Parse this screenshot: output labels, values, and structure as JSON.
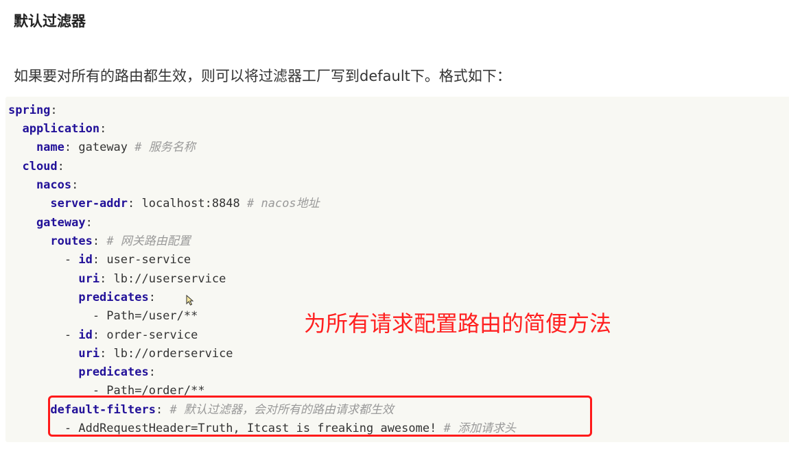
{
  "heading": "默认过滤器",
  "paragraph": "如果要对所有的路由都生效，则可以将过滤器工厂写到default下。格式如下：",
  "code_lines": [
    {
      "key": "spring",
      "punct": ":",
      "value": "",
      "comment": ""
    },
    {
      "key": "application",
      "punct": ":",
      "value": "",
      "comment": ""
    },
    {
      "key": "name",
      "punct": ":",
      "value": " gateway ",
      "comment": "# 服务名称"
    },
    {
      "key": "cloud",
      "punct": ":",
      "value": "",
      "comment": ""
    },
    {
      "key": "nacos",
      "punct": ":",
      "value": "",
      "comment": ""
    },
    {
      "key": "server-addr",
      "punct": ":",
      "value": " localhost:8848 ",
      "comment": "# nacos地址"
    },
    {
      "key": "gateway",
      "punct": ":",
      "value": "",
      "comment": ""
    },
    {
      "key": "routes",
      "punct": ":",
      "value": " ",
      "comment": "# 网关路由配置"
    },
    {
      "prefix": "- ",
      "key": "id",
      "punct": ":",
      "value": " user-service",
      "comment": ""
    },
    {
      "key": "uri",
      "punct": ":",
      "value": " lb://userservice",
      "comment": ""
    },
    {
      "key": "predicates",
      "punct": ":",
      "value": "",
      "comment": ""
    },
    {
      "prefix": "- ",
      "key": "",
      "punct": "",
      "value": "Path=/user/**",
      "comment": ""
    },
    {
      "prefix": "- ",
      "key": "id",
      "punct": ":",
      "value": " order-service",
      "comment": ""
    },
    {
      "key": "uri",
      "punct": ":",
      "value": " lb://orderservice",
      "comment": ""
    },
    {
      "key": "predicates",
      "punct": ":",
      "value": "",
      "comment": ""
    },
    {
      "prefix": "- ",
      "key": "",
      "punct": "",
      "value": "Path=/order/**",
      "comment": ""
    },
    {
      "key": "default-filters",
      "punct": ":",
      "value": " ",
      "comment": "# 默认过滤器，会对所有的路由请求都生效"
    },
    {
      "prefix": "- ",
      "key": "",
      "punct": "",
      "value": "AddRequestHeader=Truth, Itcast is freaking awesome! ",
      "comment": "# 添加请求头"
    }
  ],
  "annotation": "为所有请求配置路由的简便方法",
  "colors": {
    "key": "#221199",
    "comment": "#999999",
    "annotation": "#ff2020",
    "code_background": "#f8f8f3"
  }
}
